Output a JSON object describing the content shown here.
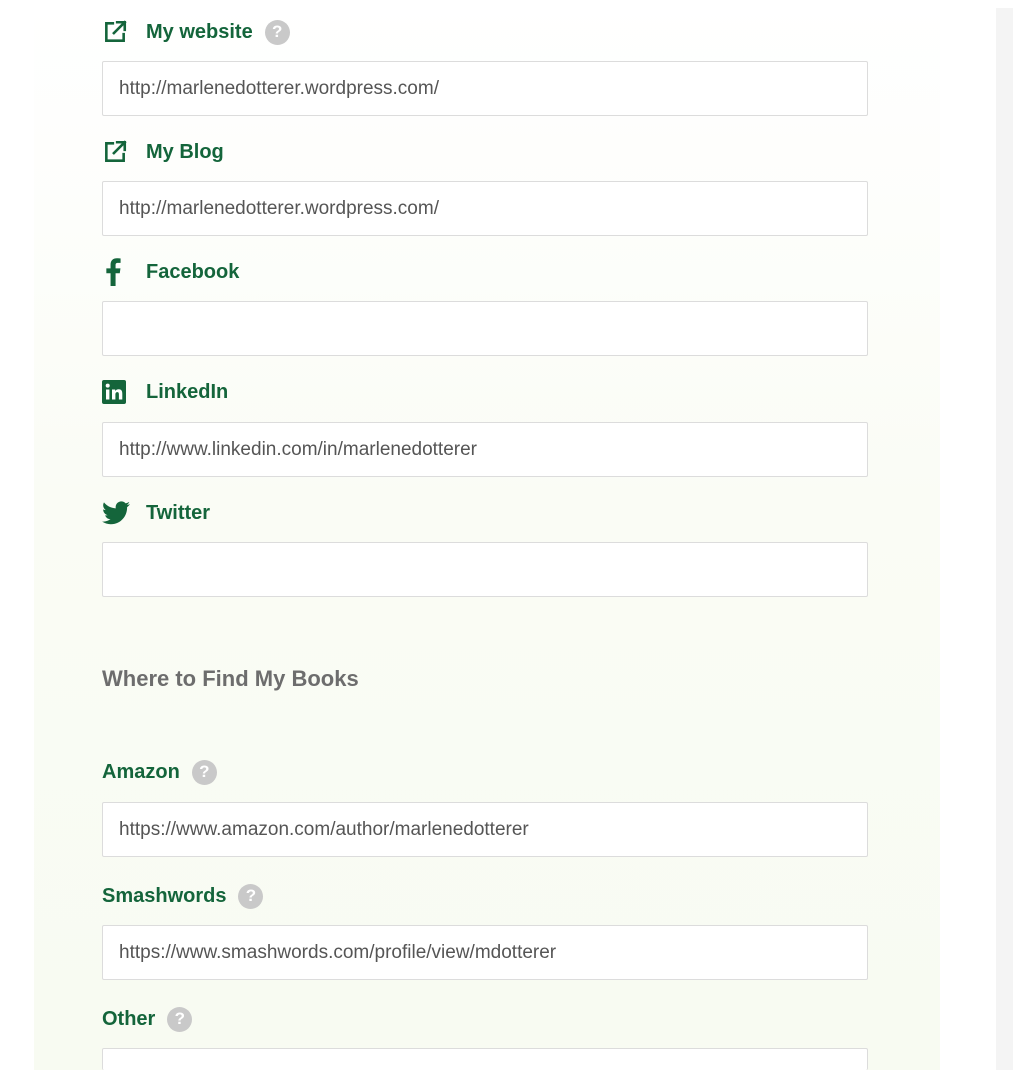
{
  "social": {
    "website": {
      "label": "My website",
      "value": "http://marlenedotterer.wordpress.com/",
      "icon": "external-link-icon",
      "help": "?"
    },
    "blog": {
      "label": "My Blog",
      "value": "http://marlenedotterer.wordpress.com/",
      "icon": "external-link-icon"
    },
    "facebook": {
      "label": "Facebook",
      "value": "",
      "icon": "facebook-icon"
    },
    "linkedin": {
      "label": "LinkedIn",
      "value": "http://www.linkedin.com/in/marlenedotterer",
      "icon": "linkedin-icon"
    },
    "twitter": {
      "label": "Twitter",
      "value": "",
      "icon": "twitter-icon"
    }
  },
  "books": {
    "heading": "Where to Find My Books",
    "amazon": {
      "label": "Amazon",
      "value": "https://www.amazon.com/author/marlenedotterer",
      "help": "?"
    },
    "smashwords": {
      "label": "Smashwords",
      "value": "https://www.smashwords.com/profile/view/mdotterer",
      "help": "?"
    },
    "other": {
      "label": "Other",
      "value": "",
      "help": "?"
    }
  },
  "colors": {
    "label_green": "#14653b",
    "heading_gray": "#6d6d6d",
    "help_gray": "#c9c9c9",
    "input_border": "#dcdcdc"
  }
}
